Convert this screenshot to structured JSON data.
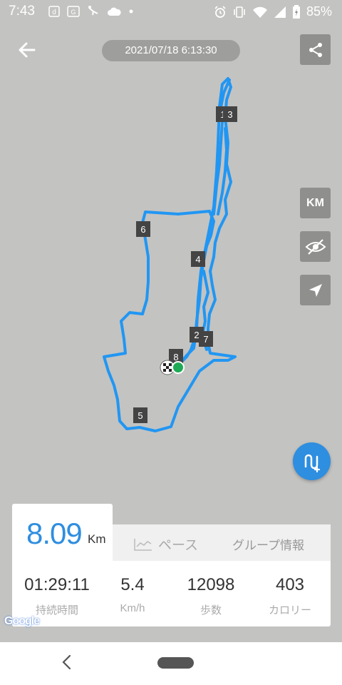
{
  "status_bar": {
    "time": "7:43",
    "battery": "85%",
    "left_icons": [
      "d-app-icon",
      "google-translate-icon",
      "step-icon",
      "cloud-icon",
      "dot-icon"
    ],
    "right_icons": [
      "alarm-icon",
      "vibrate-icon",
      "wifi-icon",
      "signal-icon",
      "battery-icon"
    ]
  },
  "header": {
    "date_time": "2021/07/18 6:13:30"
  },
  "map_controls": {
    "km_label": "KM"
  },
  "markers": [
    "1",
    "3",
    "6",
    "4",
    "2",
    "7",
    "8",
    "5"
  ],
  "stats": {
    "distance_value": "8.09",
    "distance_unit": "Km",
    "tab_pace": "ペース",
    "tab_group": "グループ情報",
    "items": [
      {
        "value": "01:29:11",
        "label": "持続時間"
      },
      {
        "value": "5.4",
        "label": "Km/h"
      },
      {
        "value": "12098",
        "label": "歩数"
      },
      {
        "value": "403",
        "label": "カロリー"
      }
    ]
  },
  "map_attribution": "Google",
  "colors": {
    "accent": "#2e8ee0",
    "route": "#2196f3",
    "map_bg": "#c3c3c1"
  }
}
